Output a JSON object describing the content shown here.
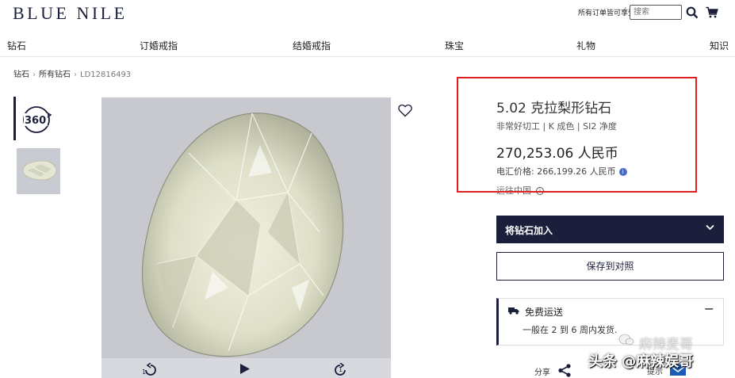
{
  "header": {
    "logo": "BLUE NILE",
    "free_shipping_notice": "所有订单皆可享受免费退货服务",
    "separator": "|",
    "search_placeholder": "搜索",
    "search_icon": "search-icon",
    "cart_icon": "cart-icon"
  },
  "nav": {
    "items": [
      "钻石",
      "订婚戒指",
      "结婚戒指",
      "珠宝",
      "礼物",
      "知识"
    ]
  },
  "breadcrumb": {
    "items": [
      "钻石",
      "所有钻石",
      "LD12816493"
    ],
    "separator": "›"
  },
  "gallery": {
    "view_360_label": "360",
    "controls": {
      "rotate_left_label": "1",
      "play_icon": "play-icon",
      "rotate_right_label": "1"
    }
  },
  "product": {
    "title": "5.02 克拉梨形钻石",
    "specs": "非常好切工 | K 成色 | SI2 净度",
    "price": "270,253.06 人民币",
    "wire_price": "电汇价格:  266,199.26 人民币",
    "ship_to": "运往中国"
  },
  "actions": {
    "add_diamond": "将钻石加入",
    "save_compare": "保存到对照"
  },
  "shipping": {
    "title": "免费运送",
    "collapse_symbol": "−",
    "description": "一般在 2 到 6 周内发货."
  },
  "footer": {
    "share": "分享",
    "tips": "提示"
  },
  "watermark": {
    "line1": "麻辣麦哥",
    "line2": "头条 @麻辣娱哥"
  },
  "colors": {
    "brand_navy": "#1b1f3b",
    "highlight_red": "#e02020",
    "info_blue": "#4a6bc7"
  }
}
